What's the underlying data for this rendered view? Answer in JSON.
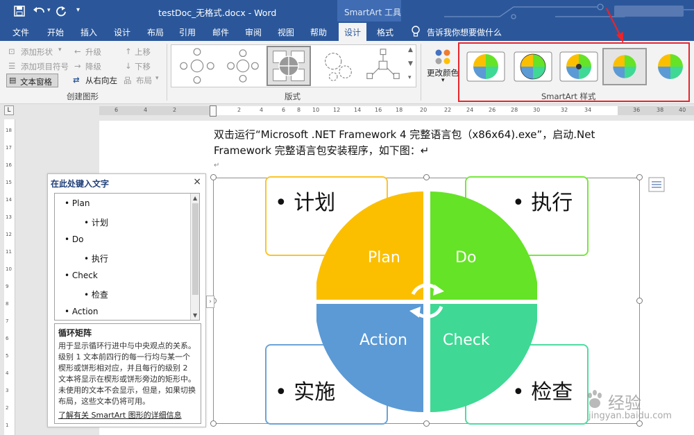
{
  "titlebar": {
    "doc_title": "testDoc_无格式.docx  -  Word",
    "context_tab": "SmartArt 工具"
  },
  "tabs": [
    "文件",
    "开始",
    "插入",
    "设计",
    "布局",
    "引用",
    "邮件",
    "审阅",
    "视图",
    "帮助",
    "设计",
    "格式"
  ],
  "tell_me": "告诉我你想要做什么",
  "ribbon": {
    "create": {
      "add_shape": "添加形状",
      "add_bullet": "添加项目符号",
      "text_pane": "文本窗格",
      "promote": "升级",
      "demote": "降级",
      "rtl": "从右向左",
      "move_up": "上移",
      "move_down": "下移",
      "layout": "布局",
      "label": "创建图形"
    },
    "layouts_label": "版式",
    "change_colors": "更改颜色",
    "styles_label": "SmartArt 样式"
  },
  "ruler": [
    "6",
    "4",
    "2",
    "2",
    "4",
    "6",
    "8",
    "10",
    "12",
    "14",
    "16",
    "18",
    "20",
    "22",
    "24",
    "26",
    "28",
    "30",
    "32",
    "34",
    "36",
    "38",
    "40"
  ],
  "vruler": [
    "18",
    "17",
    "16",
    "15",
    "14",
    "13",
    "12",
    "11",
    "10",
    "9",
    "8",
    "7",
    "6",
    "5",
    "4",
    "3",
    "2",
    "1"
  ],
  "document": {
    "line1": "双击运行“Microsoft .NET Framework 4 完整语言包（x86x64).exe”，启动.Net",
    "line2": "Framework 完整语言包安装程序，如下图：↵",
    "mark": "↵"
  },
  "text_pane": {
    "title": "在此处键入文字",
    "close": "×",
    "items": [
      {
        "level": 1,
        "text": "Plan"
      },
      {
        "level": 2,
        "text": "计划"
      },
      {
        "level": 1,
        "text": "Do"
      },
      {
        "level": 2,
        "text": "执行"
      },
      {
        "level": 1,
        "text": "Check"
      },
      {
        "level": 2,
        "text": "检查"
      },
      {
        "level": 1,
        "text": "Action"
      }
    ],
    "desc_title": "循环矩阵",
    "desc_body": "用于显示循环行进中与中央观点的关系。级别 1 文本前四行的每一行均与某一个楔形或饼形相对应，并且每行的级别 2 文本将显示在楔形或饼形旁边的矩形中。未使用的文本不会显示，但是，如果切换布局，这些文本仍将可用。",
    "desc_link": "了解有关 SmartArt 图形的详细信息"
  },
  "smartart": {
    "quadrants": [
      {
        "label": "Plan",
        "color": "#fbbf00"
      },
      {
        "label": "Do",
        "color": "#65e326"
      },
      {
        "label": "Action",
        "color": "#5b9ad5"
      },
      {
        "label": "Check",
        "color": "#40d895"
      }
    ],
    "boxes": [
      "• 计划",
      "• 执行",
      "• 实施",
      "• 检查"
    ]
  },
  "watermark": {
    "brand": "经验",
    "url": "jingyan.baidu.com"
  },
  "colors": {
    "accent": "#2b579a",
    "highlight": "#e8242c"
  }
}
